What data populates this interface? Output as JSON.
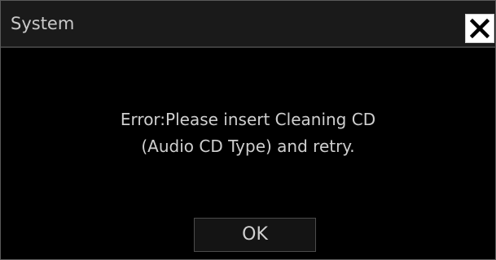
{
  "window": {
    "title": "System",
    "close_icon": "close-icon"
  },
  "message": {
    "line1": "Error:Please insert Cleaning CD",
    "line2": "(Audio CD Type) and retry."
  },
  "buttons": {
    "ok_label": "OK"
  },
  "colors": {
    "background": "#000000",
    "titlebar": "#1a1a1a",
    "text": "#cfcfcf",
    "close_button": "#ffffff"
  }
}
